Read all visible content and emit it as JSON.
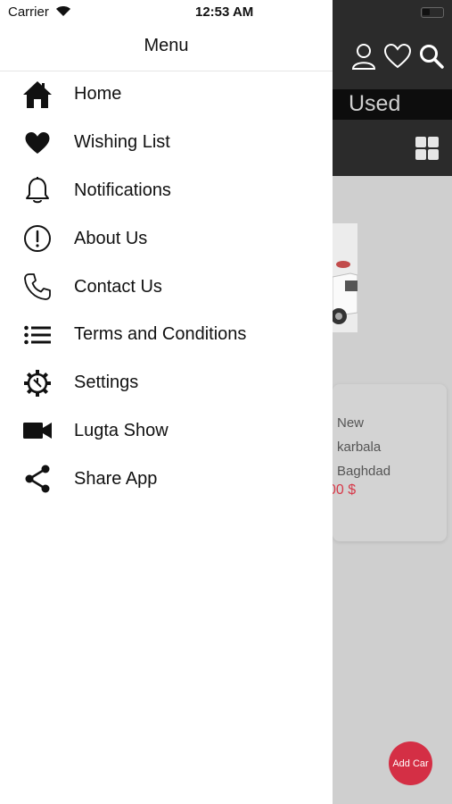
{
  "status_bar": {
    "carrier": "Carrier",
    "time": "12:53 AM"
  },
  "drawer": {
    "title": "Menu",
    "items": [
      {
        "label": "Home",
        "icon": "home-icon"
      },
      {
        "label": "Wishing List",
        "icon": "heart-icon"
      },
      {
        "label": "Notifications",
        "icon": "bell-icon"
      },
      {
        "label": "About Us",
        "icon": "info-exclamation-icon"
      },
      {
        "label": "Contact Us",
        "icon": "phone-icon"
      },
      {
        "label": "Terms and Conditions",
        "icon": "list-icon"
      },
      {
        "label": "Settings",
        "icon": "gear-icon"
      },
      {
        "label": "Lugta Show",
        "icon": "video-camera-icon"
      },
      {
        "label": "Share App",
        "icon": "share-icon"
      }
    ]
  },
  "background": {
    "tab_label": "Used",
    "card": {
      "condition": "New",
      "line2": "karbala",
      "line3": "Baghdad",
      "price": "00 $"
    },
    "add_button": "Add Car"
  },
  "colors": {
    "accent": "#d42f45",
    "header": "#2b2b2b",
    "price": "#d73a4a"
  }
}
